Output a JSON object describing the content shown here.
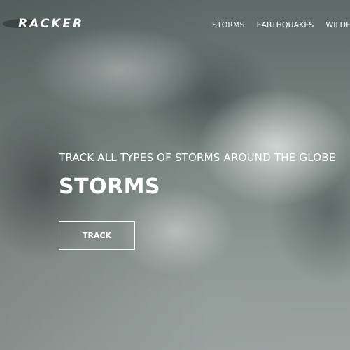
{
  "nav": {
    "logo_text": "RACKER",
    "items": [
      {
        "label": "STORMS"
      },
      {
        "label": "EARTHQUAKES"
      },
      {
        "label": "WILDFIRES"
      }
    ]
  },
  "hero": {
    "subtitle": "TRACK ALL TYPES OF STORMS AROUND THE GLOBE",
    "title": "STORMS",
    "button_label": "TRACK"
  },
  "colors": {
    "text": "#ffffff",
    "sky_base": "#7d8884"
  }
}
